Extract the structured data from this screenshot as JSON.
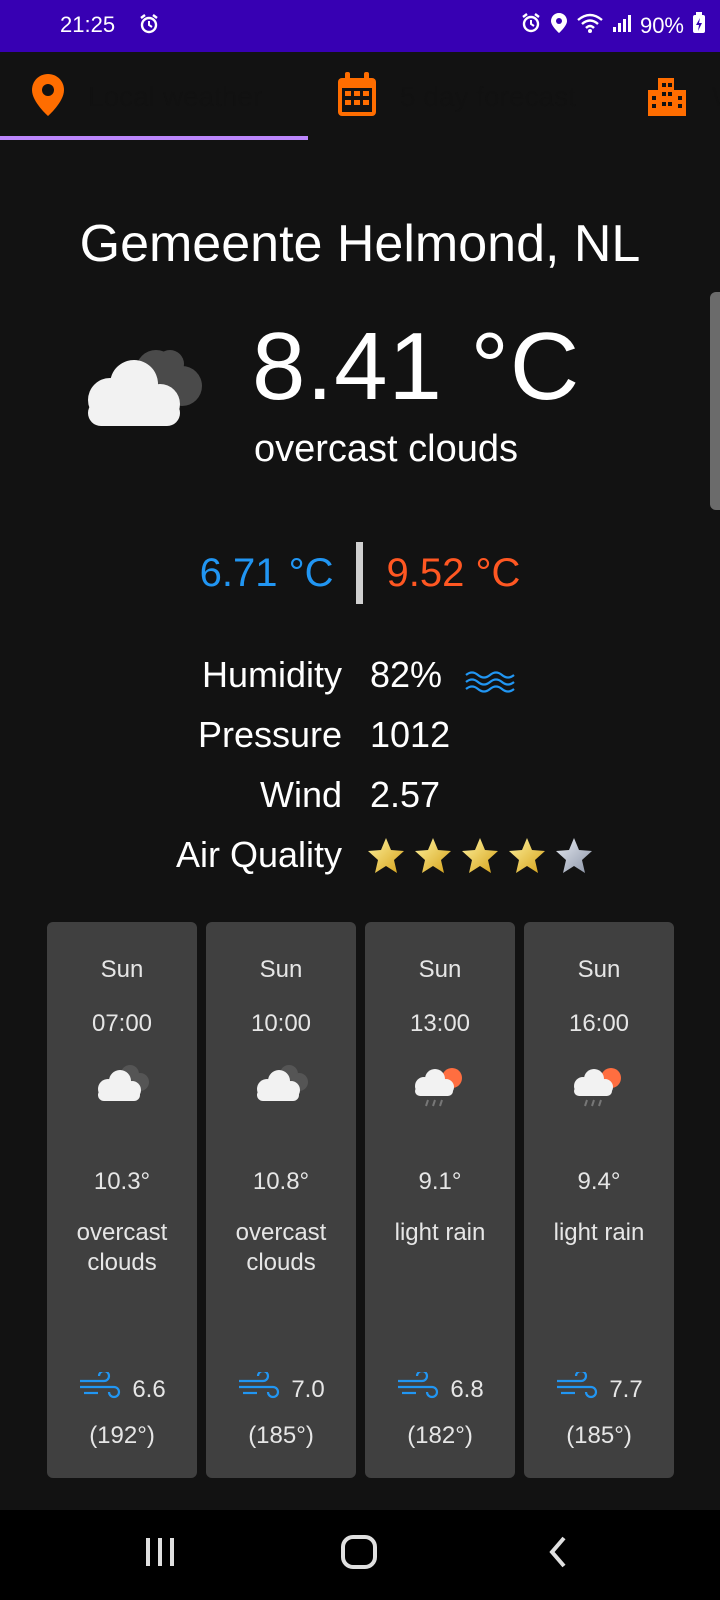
{
  "status_bar": {
    "time": "21:25",
    "battery": "90%"
  },
  "tabs": [
    {
      "label": "Local weather",
      "icon": "location-pin-icon",
      "selected": true
    },
    {
      "label": "5 day forecast",
      "icon": "calendar-icon",
      "selected": false
    },
    {
      "label": "W",
      "icon": "city-icon",
      "selected": false
    }
  ],
  "current": {
    "city": "Gemeente Helmond, NL",
    "temperature": "8.41 °C",
    "description": "overcast clouds",
    "temp_min": "6.71 °C",
    "temp_max": "9.52 °C",
    "stats": [
      {
        "label": "Humidity",
        "value": "82%"
      },
      {
        "label": "Pressure",
        "value": "1012"
      },
      {
        "label": "Wind",
        "value": "2.57"
      },
      {
        "label": "Air Quality",
        "stars_filled": 4,
        "stars_total": 5
      }
    ]
  },
  "forecast": [
    {
      "day": "Sun",
      "hour": "07:00",
      "icon": "overcast-clouds-icon",
      "temp": "10.3°",
      "desc_line1": "overcast",
      "desc_line2": "clouds",
      "wind": "6.6",
      "dir": "(192°)"
    },
    {
      "day": "Sun",
      "hour": "10:00",
      "icon": "overcast-clouds-icon",
      "temp": "10.8°",
      "desc_line1": "overcast",
      "desc_line2": "clouds",
      "wind": "7.0",
      "dir": "(185°)"
    },
    {
      "day": "Sun",
      "hour": "13:00",
      "icon": "light-rain-icon",
      "temp": "9.1°",
      "desc_line1": "light rain",
      "desc_line2": "",
      "wind": "6.8",
      "dir": "(182°)"
    },
    {
      "day": "Sun",
      "hour": "16:00",
      "icon": "light-rain-icon",
      "temp": "9.4°",
      "desc_line1": "light rain",
      "desc_line2": "",
      "wind": "7.7",
      "dir": "(185°)"
    }
  ],
  "colors": {
    "status_bar": "#3700b3",
    "accent_orange": "#ff6d00",
    "tab_indicator": "#bb86fc",
    "temp_min": "#2196f3",
    "temp_max": "#ff5722",
    "card_bg": "#404040"
  }
}
